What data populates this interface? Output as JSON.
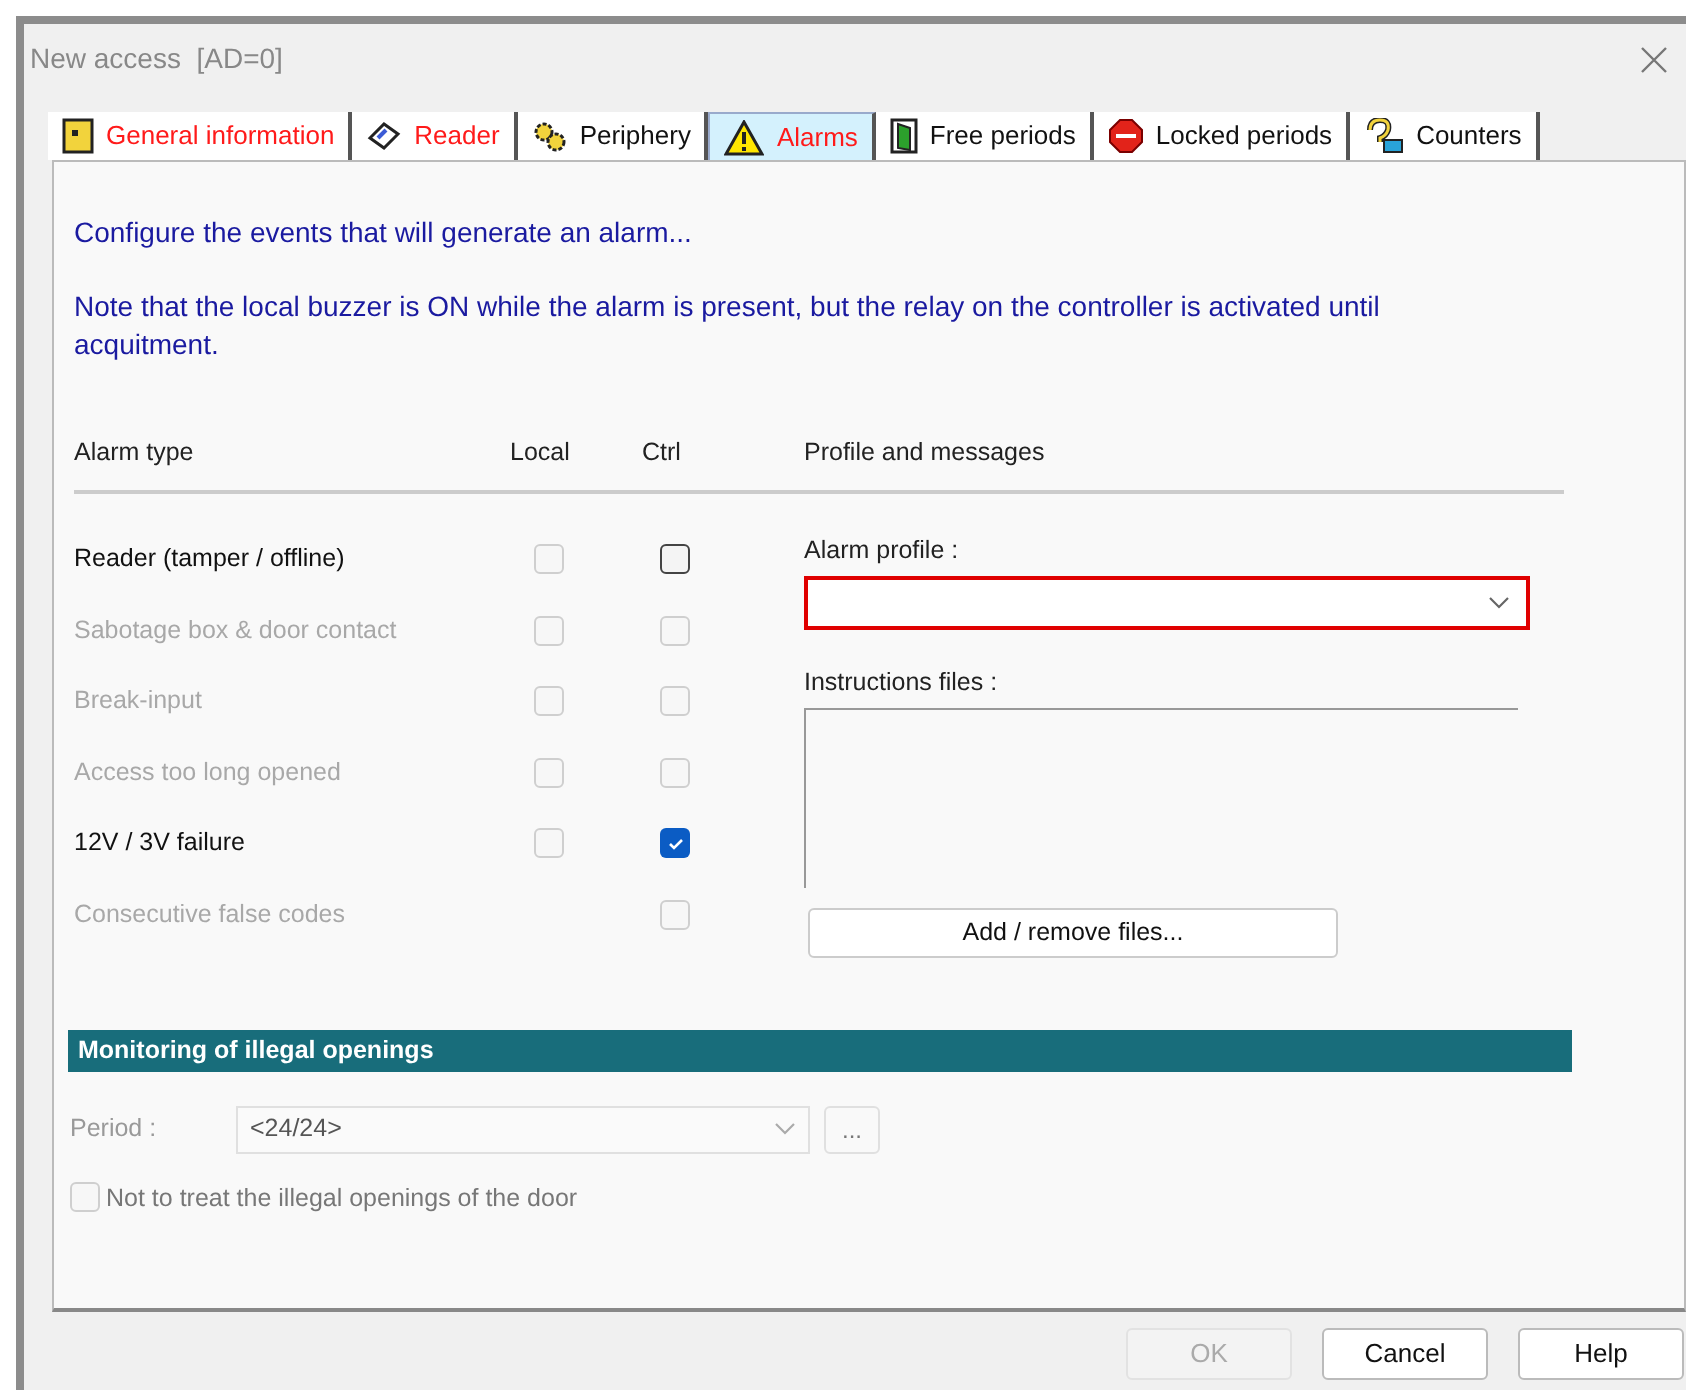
{
  "window": {
    "title": "New access  [AD=0]"
  },
  "tabs": [
    {
      "label": "General information",
      "kind": "panel",
      "flagged": true,
      "selected": false
    },
    {
      "label": "Reader",
      "kind": "card",
      "flagged": true,
      "selected": false
    },
    {
      "label": "Periphery",
      "kind": "gears",
      "flagged": false,
      "selected": false
    },
    {
      "label": "Alarms",
      "kind": "warning",
      "flagged": true,
      "selected": true
    },
    {
      "label": "Free periods",
      "kind": "door",
      "flagged": false,
      "selected": false
    },
    {
      "label": "Locked periods",
      "kind": "stop",
      "flagged": false,
      "selected": false
    },
    {
      "label": "Counters",
      "kind": "counter",
      "flagged": false,
      "selected": false
    }
  ],
  "intro": "Configure the events that will generate an alarm...",
  "note": "Note that the local buzzer is ON while the alarm is present, but the relay on the controller is activated until acquitment.",
  "columns": [
    "Alarm type",
    "Local",
    "Ctrl",
    "Profile and messages"
  ],
  "alarms": [
    {
      "name": "Reader (tamper / offline)",
      "disabled": false,
      "local": {
        "checked": false,
        "disabled": true
      },
      "ctrl": {
        "checked": false,
        "disabled": false
      }
    },
    {
      "name": "Sabotage box & door contact",
      "disabled": true,
      "local": {
        "checked": false,
        "disabled": true
      },
      "ctrl": {
        "checked": false,
        "disabled": true
      }
    },
    {
      "name": "Break-input",
      "disabled": true,
      "local": {
        "checked": false,
        "disabled": true
      },
      "ctrl": {
        "checked": false,
        "disabled": true
      }
    },
    {
      "name": "Access too long opened",
      "disabled": true,
      "local": {
        "checked": false,
        "disabled": true
      },
      "ctrl": {
        "checked": false,
        "disabled": true
      }
    },
    {
      "name": "12V / 3V failure",
      "disabled": false,
      "local": {
        "checked": false,
        "disabled": true
      },
      "ctrl": {
        "checked": true,
        "disabled": false
      }
    },
    {
      "name": "Consecutive false codes",
      "disabled": true,
      "ctrl": {
        "checked": false,
        "disabled": true
      }
    }
  ],
  "profile": {
    "label": "Alarm profile :",
    "error": true
  },
  "instructions": {
    "label": "Instructions files :",
    "button": "Add / remove files..."
  },
  "monitoring": {
    "title": "Monitoring of illegal openings",
    "period_label": "Period :",
    "period_value": "<24/24>",
    "more_button": "...",
    "ignore": {
      "label": "Not to treat the illegal openings of the door",
      "checked": false,
      "disabled": true
    }
  },
  "buttons": [
    {
      "label": "OK",
      "disabled": true
    },
    {
      "label": "Cancel",
      "disabled": false
    },
    {
      "label": "Help",
      "disabled": false
    }
  ]
}
